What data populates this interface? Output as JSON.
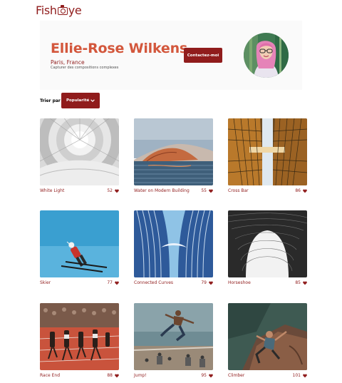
{
  "app": {
    "logo_text_left": "Fish",
    "logo_text_right": "ye"
  },
  "photographer": {
    "name": "Ellie-Rose Wilkens",
    "location": "Paris, France",
    "tagline": "Capturer des compositions complexes",
    "contact_label": "Contactez-moi"
  },
  "sort": {
    "label": "Trier par",
    "selected": "Popularité"
  },
  "media": [
    {
      "title": "White Light",
      "likes": "52"
    },
    {
      "title": "Water on Modern Building",
      "likes": "55"
    },
    {
      "title": "Cross Bar",
      "likes": "86"
    },
    {
      "title": "Skier",
      "likes": "77"
    },
    {
      "title": "Connected Curves",
      "likes": "79"
    },
    {
      "title": "Horseshoe",
      "likes": "85"
    },
    {
      "title": "Race End",
      "likes": "88"
    },
    {
      "title": "Jump!",
      "likes": "95"
    },
    {
      "title": "Climber",
      "likes": "101"
    }
  ],
  "colors": {
    "primary": "#901c1c",
    "name": "#d3573c",
    "header_bg": "#fafafa"
  },
  "icons": {
    "like": "heart-icon",
    "sort_toggle": "chevron-down-icon",
    "logo": "camera-icon"
  }
}
